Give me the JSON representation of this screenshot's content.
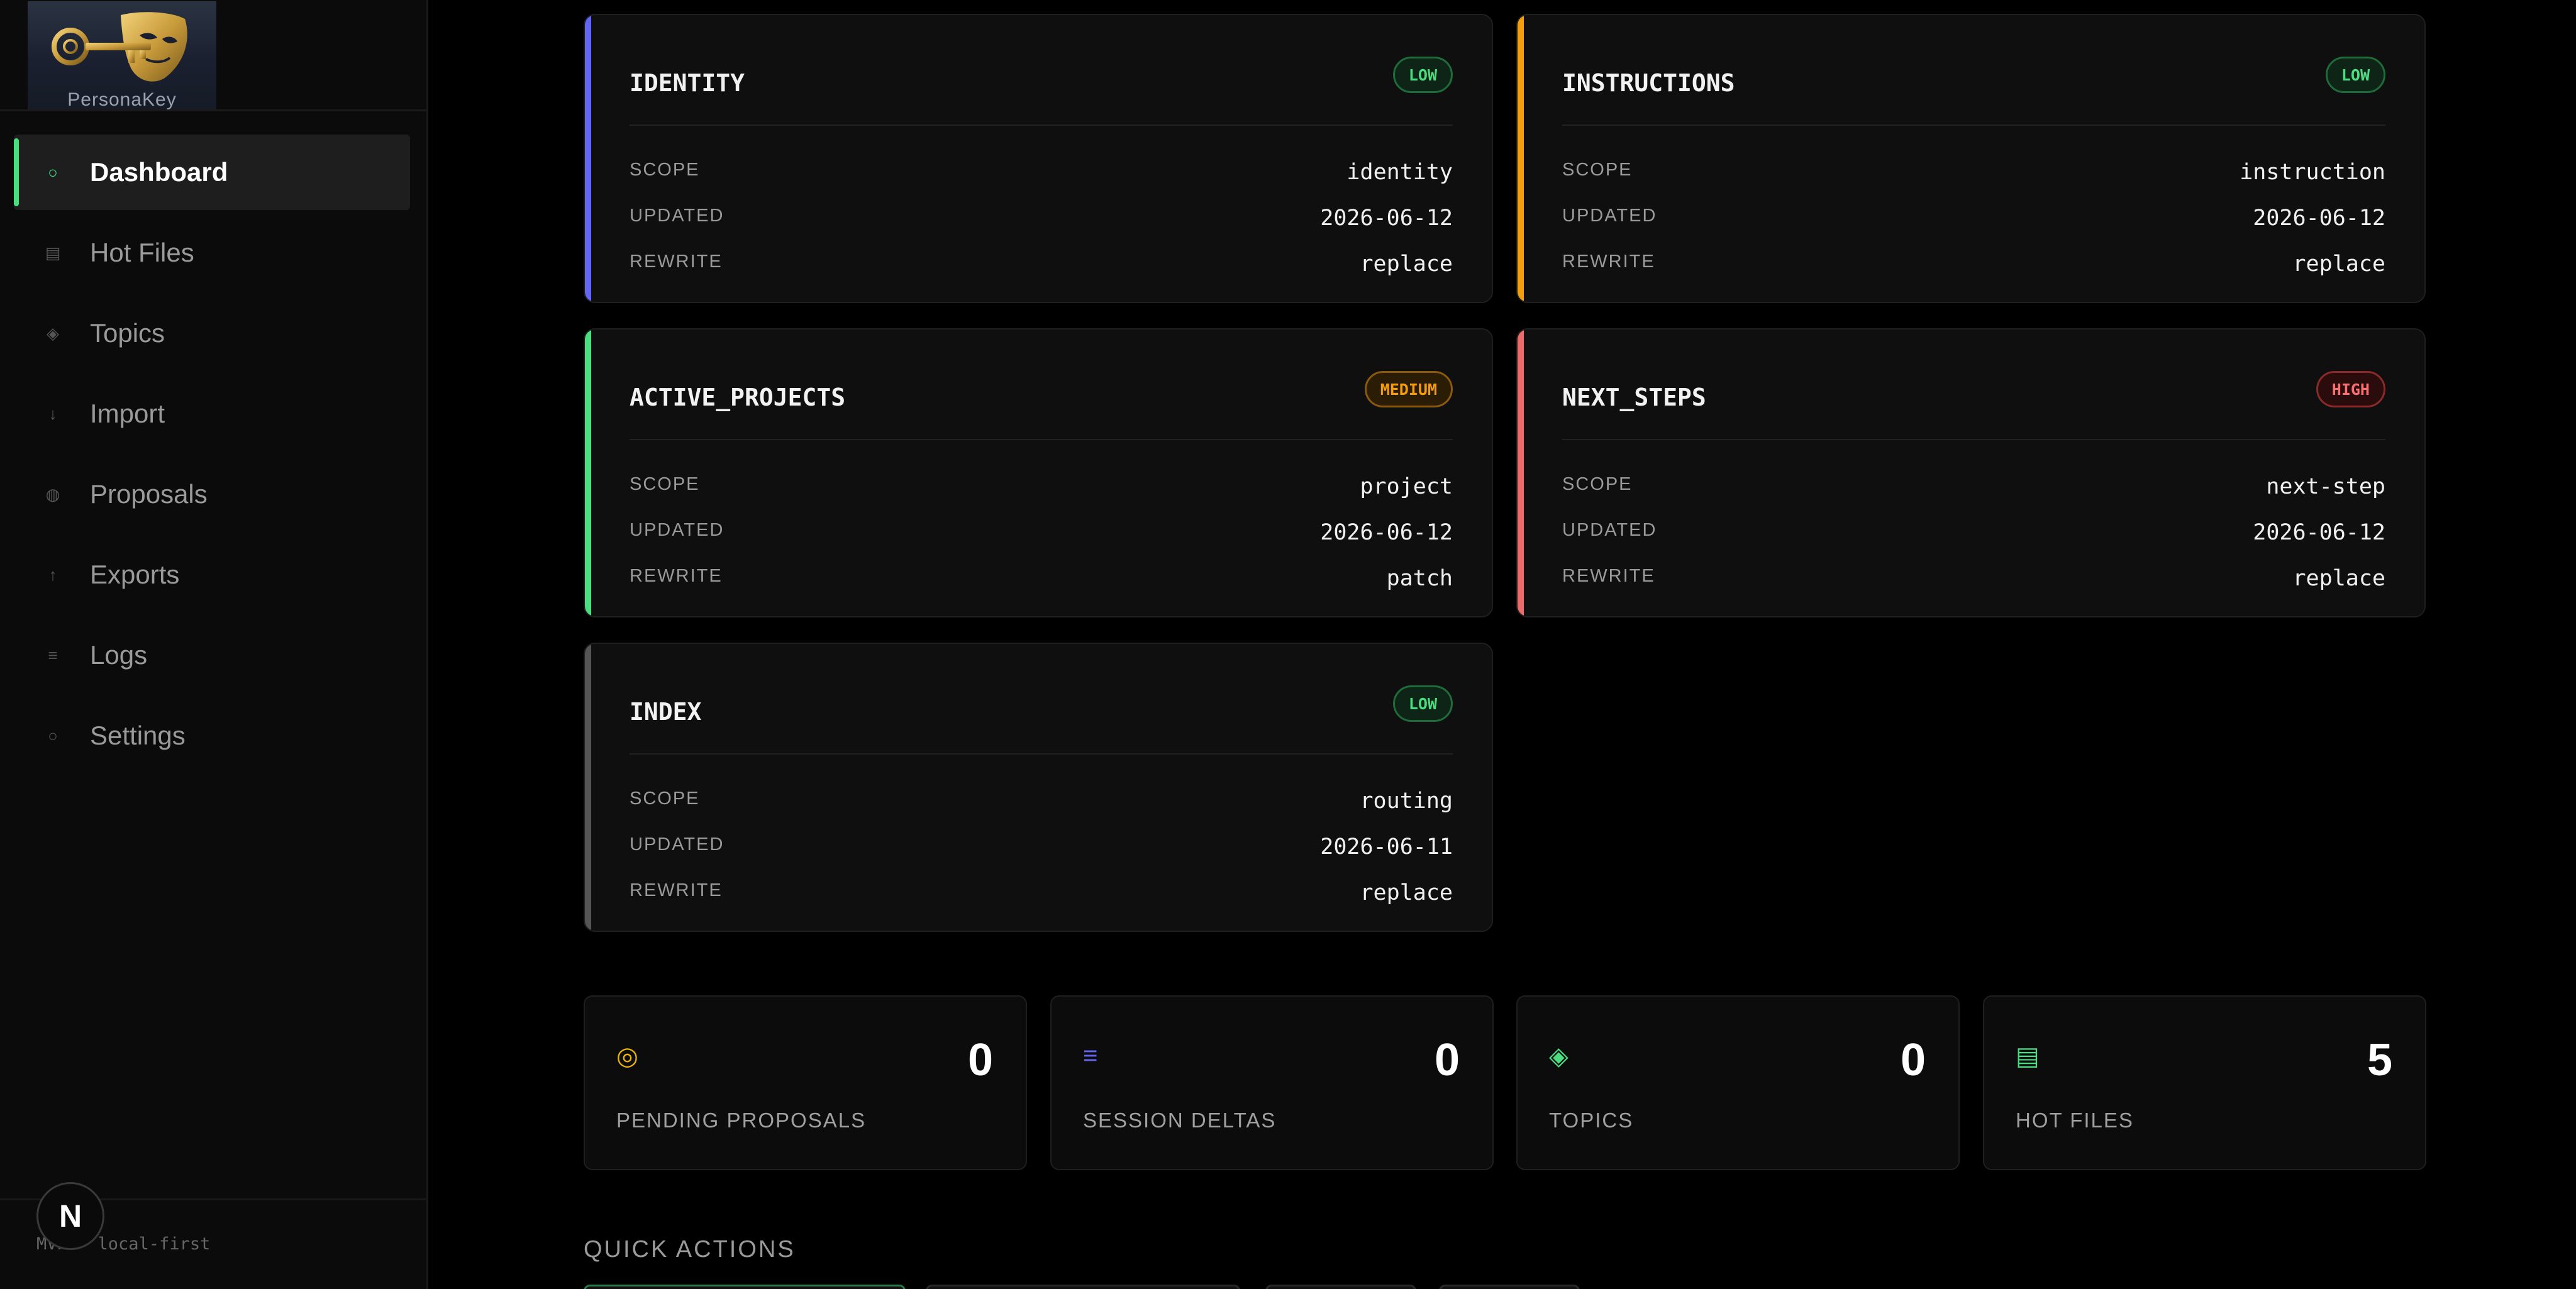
{
  "brand": {
    "name": "PersonaKey"
  },
  "sidebar": {
    "items": [
      {
        "label": "Dashboard",
        "icon": "circle-icon",
        "glyph": "○"
      },
      {
        "label": "Hot Files",
        "icon": "file-list-icon",
        "glyph": "▤"
      },
      {
        "label": "Topics",
        "icon": "diamond-icon",
        "glyph": "◈"
      },
      {
        "label": "Import",
        "icon": "arrow-down-icon",
        "glyph": "↓"
      },
      {
        "label": "Proposals",
        "icon": "dot-circle-icon",
        "glyph": "◍"
      },
      {
        "label": "Exports",
        "icon": "arrow-up-icon",
        "glyph": "↑"
      },
      {
        "label": "Logs",
        "icon": "lines-icon",
        "glyph": "≡"
      },
      {
        "label": "Settings",
        "icon": "settings-circle-icon",
        "glyph": "○"
      }
    ],
    "footer": "MVP · local-first",
    "badge": "N"
  },
  "cards": [
    {
      "title": "IDENTITY",
      "badge": "LOW",
      "level": "low",
      "accent": "#6366f1",
      "scope": "identity",
      "updated": "2026-06-12",
      "rewrite": "replace"
    },
    {
      "title": "INSTRUCTIONS",
      "badge": "LOW",
      "level": "low",
      "accent": "#f59e0b",
      "scope": "instruction",
      "updated": "2026-06-12",
      "rewrite": "replace"
    },
    {
      "title": "ACTIVE_PROJECTS",
      "badge": "MEDIUM",
      "level": "medium",
      "accent": "#4ade80",
      "scope": "project",
      "updated": "2026-06-12",
      "rewrite": "patch"
    },
    {
      "title": "NEXT_STEPS",
      "badge": "HIGH",
      "level": "high",
      "accent": "#ef6b6b",
      "scope": "next-step",
      "updated": "2026-06-12",
      "rewrite": "replace"
    },
    {
      "title": "INDEX",
      "badge": "LOW",
      "level": "low",
      "accent": "#555555",
      "scope": "routing",
      "updated": "2026-06-11",
      "rewrite": "replace"
    }
  ],
  "card_labels": {
    "scope": "SCOPE",
    "updated": "UPDATED",
    "rewrite": "REWRITE"
  },
  "stats": [
    {
      "label": "PENDING PROPOSALS",
      "value": "0",
      "icon": "target-icon",
      "glyph": "◎",
      "color": "#eab308"
    },
    {
      "label": "SESSION DELTAS",
      "value": "0",
      "icon": "lines-icon",
      "glyph": "≡",
      "color": "#6366f1"
    },
    {
      "label": "TOPICS",
      "value": "0",
      "icon": "diamond-icon",
      "glyph": "◈",
      "color": "#4ade80"
    },
    {
      "label": "HOT FILES",
      "value": "5",
      "icon": "file-list-icon",
      "glyph": "▤",
      "color": "#4ade80"
    }
  ],
  "quick_actions": {
    "heading": "QUICK ACTIONS"
  }
}
